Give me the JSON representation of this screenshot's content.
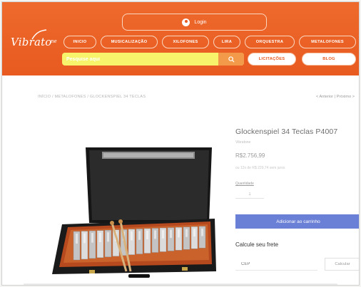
{
  "header": {
    "logo_text": "Vibrato",
    "logo_tail": "ne",
    "login_label": "Login",
    "nav": [
      {
        "label": "INICIO"
      },
      {
        "label": "MUSICALIZAÇÃO"
      },
      {
        "label": "XILOFONES"
      },
      {
        "label": "LIRA"
      },
      {
        "label": "ORQUESTRA"
      },
      {
        "label": "METALOFONES"
      }
    ],
    "search_placeholder": "Pesquise aqui",
    "licitacoes_label": "LICITAÇÕES",
    "blog_label": "BLOG"
  },
  "breadcrumb": {
    "text": "INÍCIO / METALOFONES / GLOCKENSPIEL 34 TECLAS",
    "pager": "< Anterior | Próximo >"
  },
  "product": {
    "title": "Glockenspiel 34 Teclas   P4007",
    "brand": "Vibratone",
    "price": "R$2.756,99",
    "installments": "ou 12x de R$ 229,74 sem juros",
    "qty_label": "Quantidade",
    "qty_value": "1",
    "add_to_cart": "Adicionar ao carrinho",
    "freight_title": "Calcule seu frete",
    "cep_placeholder": "CEP",
    "calc_label": "Calcular"
  },
  "colors": {
    "header_orange": "#e85a20",
    "search_yellow": "#f7f36b",
    "cart_blue": "#6a7fd6"
  }
}
